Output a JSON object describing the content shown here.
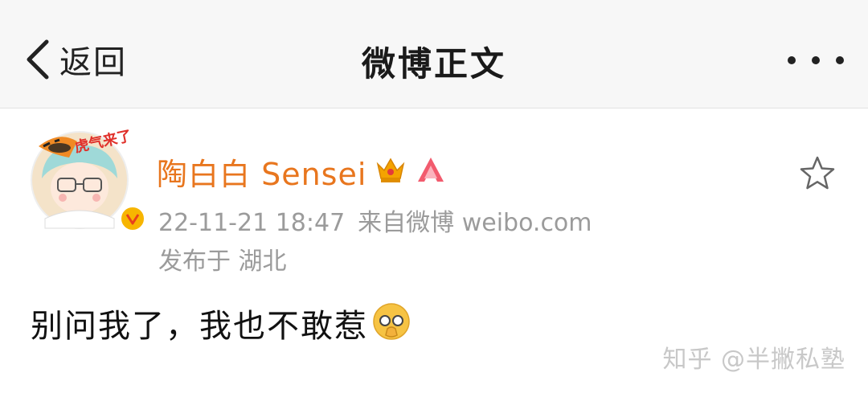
{
  "header": {
    "back_label": "返回",
    "title": "微博正文"
  },
  "post": {
    "author": "陶白白 Sensei",
    "timestamp": "22-11-21 18:47",
    "source": "来自微博 weibo.com",
    "location": "发布于 湖北",
    "text": "别问我了，我也不敢惹",
    "avatar_caption": "虎气来了"
  },
  "watermark": "知乎 @半撇私塾",
  "colors": {
    "author": "#e8761e",
    "meta": "#9b9b9b",
    "header_bg": "#f7f7f7",
    "verified_badge": "#f7b500",
    "member_crown": "#f4a300",
    "emoji": "#f6c343"
  }
}
